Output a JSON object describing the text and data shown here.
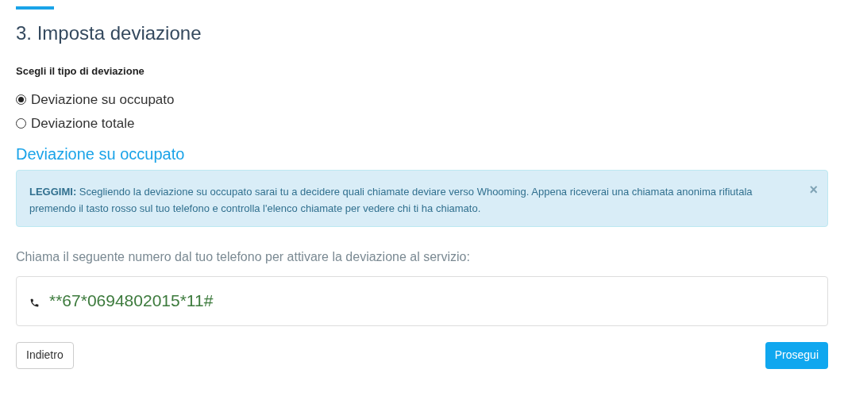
{
  "title": "3. Imposta deviazione",
  "type_label": "Scegli il tipo di deviazione",
  "options": [
    {
      "label": "Deviazione su occupato",
      "selected": true
    },
    {
      "label": "Deviazione totale",
      "selected": false
    }
  ],
  "section_title": "Deviazione su occupato",
  "alert": {
    "text": "**LEGGIMI:** Scegliendo la deviazione su occupato sarai tu a decidere quali chiamate deviare verso Whooming. Appena riceverai una chiamata anonima rifiutala premendo il tasto rosso sul tuo telefono e controlla l'elenco chiamate per vedere chi ti ha chiamato.",
    "close": "×"
  },
  "instruction": "Chiama il seguente numero dal tuo telefono per attivare la deviazione al servizio:",
  "dial_code": "**67*0694802015*11#",
  "buttons": {
    "back": "Indietro",
    "next": "Prosegui"
  }
}
